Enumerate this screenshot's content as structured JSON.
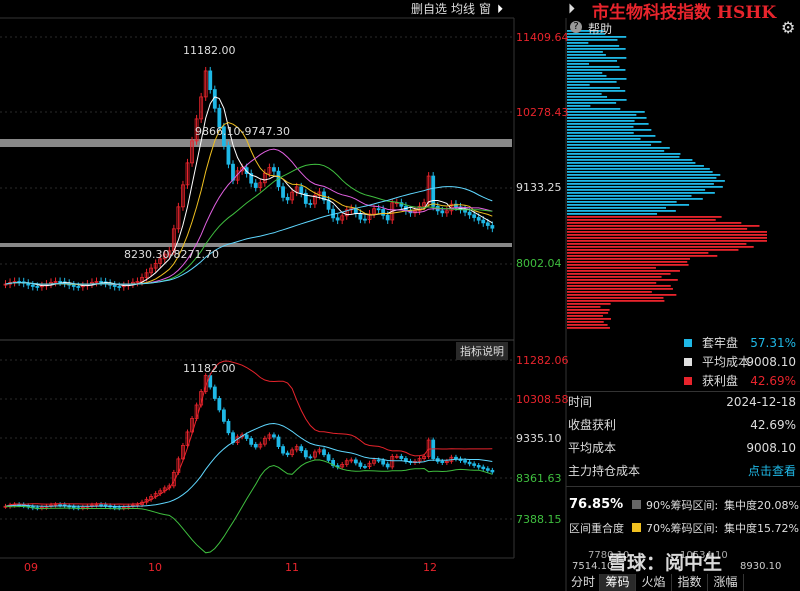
{
  "toolbar": {
    "delete_label": "删自选",
    "periods_label": "均线",
    "window_label": "窗",
    "play_icon": "play-icon"
  },
  "header": {
    "title": "市生物科技指数 HSHK",
    "help_label": "帮助",
    "settings_icon": "gear-icon"
  },
  "main_chart": {
    "price_axis": [
      "11409.64",
      "10278.43",
      "9133.25",
      "8002.04"
    ],
    "peak_label": "11182.00",
    "upper_band_label": "9866.10-9747.30",
    "lower_band_label": "8230.30-8271.70"
  },
  "sub_chart": {
    "indicator_button": "指标说明",
    "price_axis": [
      "11282.06",
      "10308.58",
      "9335.10",
      "8361.63",
      "7388.15"
    ],
    "peak_label": "11182.00"
  },
  "x_axis": {
    "months": [
      "09",
      "10",
      "11",
      "12"
    ]
  },
  "chip_legend": {
    "items": [
      {
        "label": "套牢盘",
        "value": "57.31%",
        "color": "#1fb8e6"
      },
      {
        "label": "平均成本",
        "value": "9008.10",
        "color": "#e0e0e0"
      },
      {
        "label": "获利盘",
        "value": "42.69%",
        "color": "#e8242c"
      }
    ]
  },
  "stats": {
    "time_label": "时间",
    "time_value": "2024-12-18",
    "profit_label": "收盘获利",
    "profit_value": "42.69%",
    "avg_cost_label": "平均成本",
    "avg_cost_value": "9008.10",
    "main_cost_label": "主力持仓成本",
    "main_cost_value": "点击查看",
    "big_pct": "76.85%",
    "band90_label": "90%筹码区间:",
    "band90_conc": "集中度20.08%",
    "overlap_label": "区间重合度",
    "band70_label": "70%筹码区间:",
    "band70_conc": "集中度15.72%",
    "range_low": "7514.10",
    "range_high": "8930.10",
    "range_low2": "7780.10",
    "range_high2": "10534.10"
  },
  "watermark": "雪球：阅中生",
  "tabs": [
    "分时",
    "筹码",
    "火焰",
    "指数",
    "涨幅"
  ],
  "active_tab": 1
}
